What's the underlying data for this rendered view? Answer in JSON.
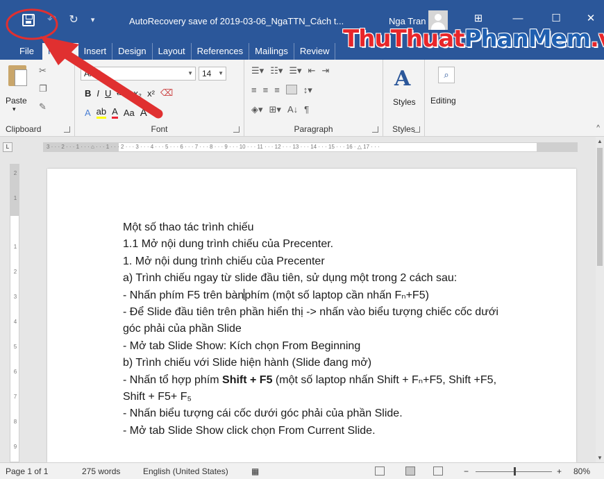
{
  "window": {
    "title": "AutoRecovery save of 2019-03-06_NgaTTN_Cách t...",
    "user_name": "Nga Tran"
  },
  "watermark": {
    "part1": "Thu",
    "part2": "Thuat",
    "part3": "PhanMem",
    "part4": ".vn"
  },
  "tabs": [
    "File",
    "Home",
    "Insert",
    "Design",
    "Layout",
    "References",
    "Mailings",
    "Review"
  ],
  "ribbon": {
    "clipboard": {
      "paste_label": "Paste",
      "group_label": "Clipboard"
    },
    "font": {
      "font_name": "Arial",
      "font_size": "14",
      "group_label": "Font",
      "bold": "B",
      "italic": "I",
      "underline": "U",
      "strike": "abc",
      "subscript": "x₂",
      "superscript": "x²",
      "effects": "A",
      "highlight": "ab",
      "font_color": "A",
      "change_case": "Aa",
      "grow": "A",
      "shrink": "A"
    },
    "paragraph": {
      "group_label": "Paragraph",
      "sort": "A↓",
      "pilcrow": "¶"
    },
    "styles": {
      "label": "Styles",
      "group_label": "Styles"
    },
    "editing": {
      "label": "Editing"
    }
  },
  "ruler_text": "3 · · · 2 · · · 1 · · · ⌂ · · · 1 · · · 2 · · · 3 · · · 4 · · · 5 · · · 6 · · · 7 · · · 8 · · · 9 · · · 10 · · · 11 · · · 12 · · · 13 · · · 14 · · · 15 · · · 16 · △ 17 · · ·",
  "vruler_nums": [
    "2",
    "1",
    "1",
    "2",
    "3",
    "4",
    "5",
    "6",
    "7",
    "8",
    "9"
  ],
  "document": {
    "lines": [
      "Một số thao tác trình chiếu",
      "1.1 Mở nội dung trình chiếu của Precenter.",
      "1. Mở nội dung trình chiếu của Precenter",
      "a) Trình chiếu ngay từ slide đầu tiên, sử dụng một trong 2 cách sau:",
      "- Nhấn phím F5 trên bàn",
      "phím (một số laptop cần nhấn Fₙ+F5)",
      "- Để Slide đầu tiên trên phần hiển thị -> nhấn vào biểu tượng chiếc cốc dưới",
      "góc phải của phần Slide",
      "- Mở tab Slide Show: Kích chọn From Beginning",
      "b) Trình chiếu với Slide hiện hành (Slide đang mở)",
      "- Nhấn tổ hợp phím ",
      "Shift + F5",
      " (một số laptop nhấn Shift + Fₙ+F5, Shift +F5,",
      "Shift + F5+ F₅",
      "- Nhấn biểu tượng cái cốc dưới góc phải của phần Slide.",
      "- Mở tab Slide Show click chọn From Current Slide."
    ]
  },
  "status": {
    "page": "Page 1 of 1",
    "words": "275 words",
    "language": "English (United States)",
    "zoom_minus": "−",
    "zoom_plus": "+",
    "zoom": "80%"
  },
  "colors": {
    "title_bar": "#2b579a",
    "annotation_red": "#e03030",
    "watermark_red": "#e8262a",
    "watermark_blue": "#1f5fb0"
  }
}
